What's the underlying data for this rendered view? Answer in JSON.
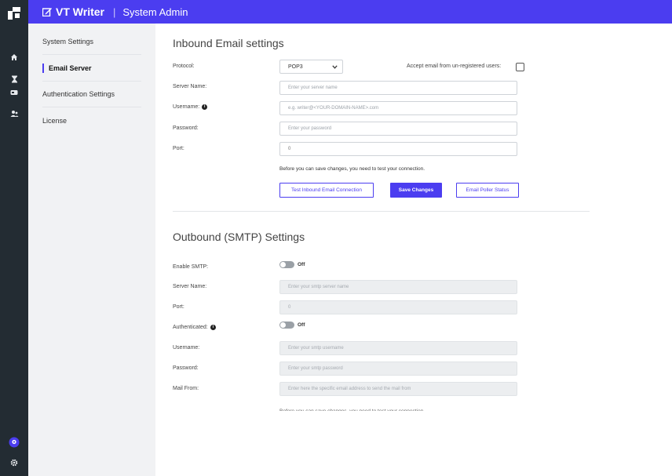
{
  "topbar": {
    "app_name": "VT Writer",
    "separator": "|",
    "section": "System Admin"
  },
  "rail": {
    "icons": [
      "home-icon",
      "hourglass-icon",
      "card-icon",
      "users-icon",
      "help-icon",
      "gear-icon"
    ]
  },
  "sidebar": {
    "items": [
      {
        "label": "System Settings"
      },
      {
        "label": "Email Server",
        "active": true
      },
      {
        "label": "Authentication Settings"
      },
      {
        "label": "License"
      }
    ]
  },
  "inbound": {
    "title": "Inbound Email settings",
    "protocol_label": "Protocol:",
    "protocol_value": "POP3",
    "accept_label": "Accept email from un-registered users:",
    "server_label": "Server Name:",
    "server_placeholder": "Enter your server name",
    "username_label": "Username:",
    "username_placeholder": "e.g. writer@<YOUR-DOMAIN-NAME>.com",
    "password_label": "Password:",
    "password_placeholder": "Enter your password",
    "port_label": "Port:",
    "port_value": "0",
    "note": "Before you can save changes, you need to test your connection.",
    "test_button": "Test Inbound Email Connection",
    "save_button": "Save Changes",
    "poller_button": "Email Poller Status"
  },
  "outbound": {
    "title": "Outbound (SMTP) Settings",
    "enable_label": "Enable SMTP:",
    "enable_state": "Off",
    "server_label": "Server Name:",
    "server_placeholder": "Enter your smtp server name",
    "port_label": "Port:",
    "port_value": "0",
    "auth_label": "Authenticated:",
    "auth_state": "Off",
    "username_label": "Username:",
    "username_placeholder": "Enter your smtp username",
    "password_label": "Password:",
    "password_placeholder": "Enter your smtp password",
    "mailfrom_label": "Mail From:",
    "mailfrom_placeholder": "Enter here the specific email address to send the mail from",
    "note": "Before you can save changes, you need to test your connection."
  },
  "colors": {
    "accent": "#4b3df0",
    "rail": "#232c33",
    "sidebar": "#f1f2f4"
  }
}
